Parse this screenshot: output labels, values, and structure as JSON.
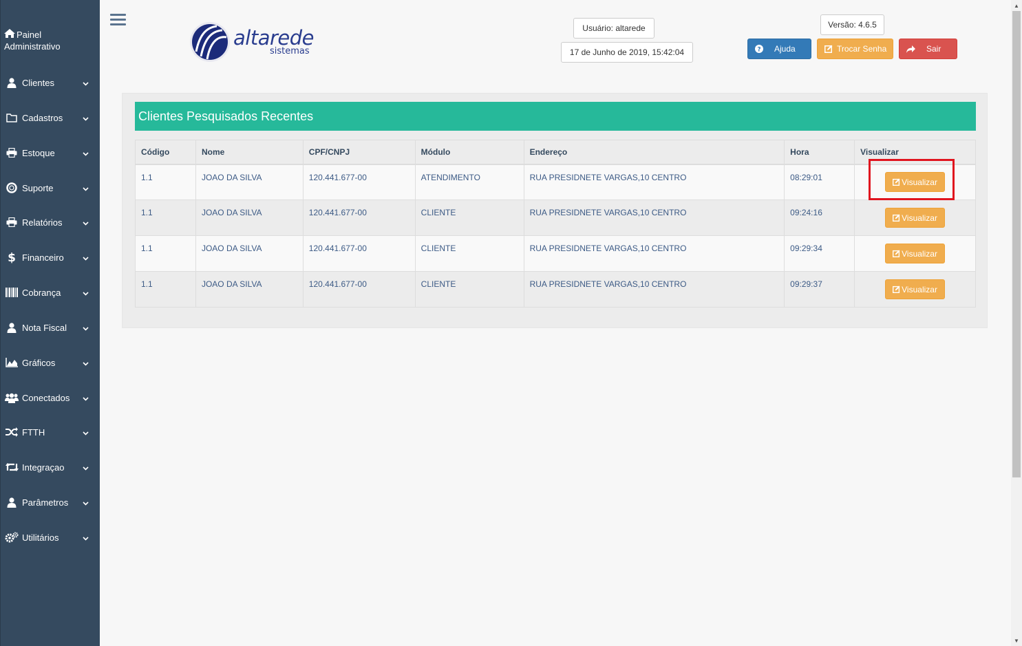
{
  "sidebar": {
    "top_label_line1": "Painel",
    "top_label_line2": "Administrativo",
    "items": [
      {
        "label": "Clientes",
        "icon": "user-icon"
      },
      {
        "label": "Cadastros",
        "icon": "folder-icon"
      },
      {
        "label": "Estoque",
        "icon": "printer-icon"
      },
      {
        "label": "Suporte",
        "icon": "lifebuoy-icon"
      },
      {
        "label": "Relatórios",
        "icon": "printer-icon"
      },
      {
        "label": "Financeiro",
        "icon": "dollar-icon"
      },
      {
        "label": "Cobrança",
        "icon": "barcode-icon"
      },
      {
        "label": "Nota Fiscal",
        "icon": "user-icon"
      },
      {
        "label": "Gráficos",
        "icon": "area-chart-icon"
      },
      {
        "label": "Conectados",
        "icon": "users-icon"
      },
      {
        "label": "FTTH",
        "icon": "random-icon"
      },
      {
        "label": "Integraçao",
        "icon": "retweet-icon"
      },
      {
        "label": "Parâmetros",
        "icon": "user-icon"
      },
      {
        "label": "Utilitários",
        "icon": "cogs-icon"
      }
    ]
  },
  "header": {
    "logo_word": "altarede",
    "logo_sub": "sistemas",
    "user": "Usuário: altarede",
    "datetime": "17 de Junho de 2019, 15:42:04",
    "version": "Versão: 4.6.5",
    "help_label": "Ajuda",
    "change_password_label": "Trocar Senha",
    "exit_label": "Sair"
  },
  "panel": {
    "title": "Clientes Pesquisados Recentes",
    "columns": [
      "Código",
      "Nome",
      "CPF/CNPJ",
      "Módulo",
      "Endereço",
      "Hora",
      "Visualizar"
    ],
    "rows": [
      {
        "codigo": "1.1",
        "nome": "JOAO DA SILVA",
        "cpf": "120.441.677-00",
        "modulo": "ATENDIMENTO",
        "endereco": "RUA PRESIDNETE VARGAS,10 CENTRO",
        "hora": "08:29:01",
        "action": "Visualizar"
      },
      {
        "codigo": "1.1",
        "nome": "JOAO DA SILVA",
        "cpf": "120.441.677-00",
        "modulo": "CLIENTE",
        "endereco": "RUA PRESIDNETE VARGAS,10 CENTRO",
        "hora": "09:24:16",
        "action": "Visualizar"
      },
      {
        "codigo": "1.1",
        "nome": "JOAO DA SILVA",
        "cpf": "120.441.677-00",
        "modulo": "CLIENTE",
        "endereco": "RUA PRESIDNETE VARGAS,10 CENTRO",
        "hora": "09:29:34",
        "action": "Visualizar"
      },
      {
        "codigo": "1.1",
        "nome": "JOAO DA SILVA",
        "cpf": "120.441.677-00",
        "modulo": "CLIENTE",
        "endereco": "RUA PRESIDNETE VARGAS,10 CENTRO",
        "hora": "09:29:37",
        "action": "Visualizar"
      }
    ]
  },
  "colors": {
    "sidebar_bg": "#354a5f",
    "panel_title_bg": "#26b99a",
    "help_button": "#337ab7",
    "warning_button": "#f0ad4e",
    "danger_button": "#d9534f",
    "highlight_box": "#e0141e"
  }
}
